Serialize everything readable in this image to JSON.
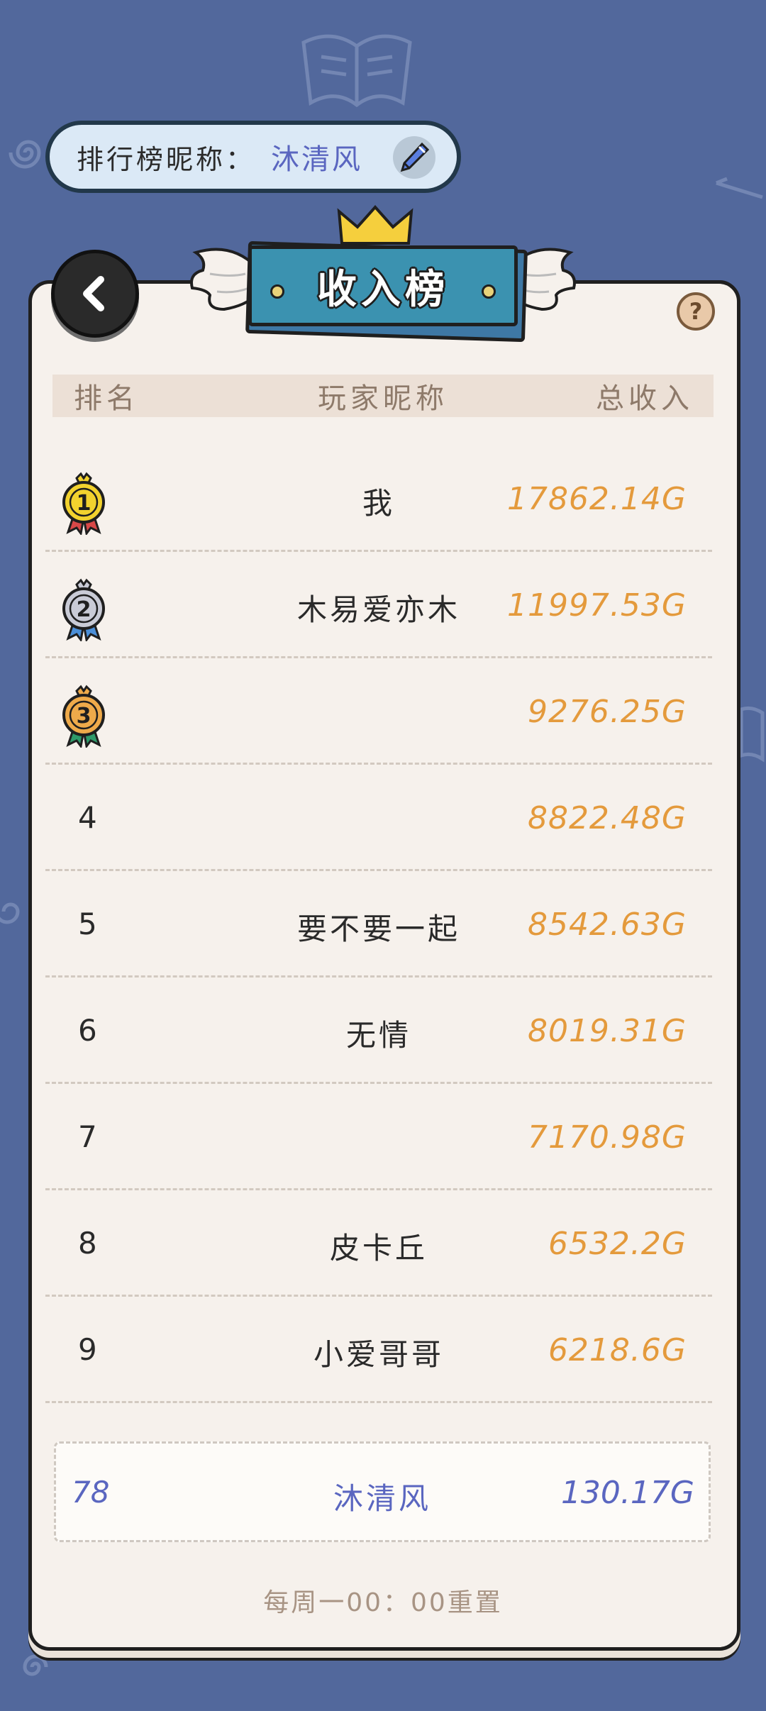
{
  "nickname_bar": {
    "label": "排行榜昵称：",
    "value": "沐清风",
    "edit_icon": "pencil-icon"
  },
  "panel": {
    "title": "收入榜",
    "back_icon": "chevron-left-icon",
    "help_icon": "question-icon",
    "help_label": "?"
  },
  "table": {
    "headers": {
      "rank": "排名",
      "name": "玩家昵称",
      "income": "总收入"
    },
    "rows": [
      {
        "rank": "1",
        "name": "我",
        "income": "17862.14G",
        "medal": "gold"
      },
      {
        "rank": "2",
        "name": "木易爱亦木",
        "income": "11997.53G",
        "medal": "silver"
      },
      {
        "rank": "3",
        "name": "",
        "income": "9276.25G",
        "medal": "bronze"
      },
      {
        "rank": "4",
        "name": "",
        "income": "8822.48G"
      },
      {
        "rank": "5",
        "name": "要不要一起",
        "income": "8542.63G"
      },
      {
        "rank": "6",
        "name": "无情",
        "income": "8019.31G"
      },
      {
        "rank": "7",
        "name": "",
        "income": "7170.98G"
      },
      {
        "rank": "8",
        "name": "皮卡丘",
        "income": "6532.2G"
      },
      {
        "rank": "9",
        "name": "小爱哥哥",
        "income": "6218.6G"
      }
    ]
  },
  "my_entry": {
    "rank": "78",
    "name": "沐清风",
    "income": "130.17G"
  },
  "footer": {
    "reset_note": "每周一00：00重置"
  },
  "colors": {
    "background": "#52689c",
    "paper": "#f6f1ec",
    "income": "#e49a3c",
    "highlight": "#5a66c0",
    "banner": "#3b92b0",
    "gold": "#f2d22e",
    "silver": "#c9cbd6",
    "bronze": "#eeaa4a"
  }
}
